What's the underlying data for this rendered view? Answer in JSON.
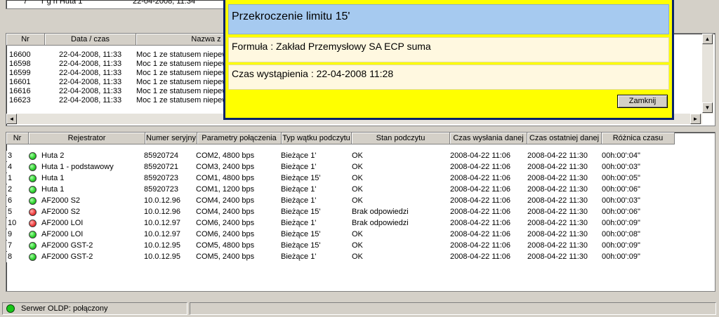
{
  "top_row": {
    "nr": "7",
    "text": "T g h Huta 1",
    "date": "22-04-2008, 11:34"
  },
  "events": {
    "headers": {
      "nr": "Nr",
      "date": "Data / czas",
      "name": "Nazwa z"
    },
    "rows": [
      {
        "nr": "16600",
        "date": "22-04-2008, 11:33",
        "name": "Moc 1 ze statusem niepew"
      },
      {
        "nr": "16598",
        "date": "22-04-2008, 11:33",
        "name": "Moc 1 ze statusem niepew"
      },
      {
        "nr": "16599",
        "date": "22-04-2008, 11:33",
        "name": "Moc 1 ze statusem niepew"
      },
      {
        "nr": "16601",
        "date": "22-04-2008, 11:33",
        "name": "Moc 1 ze statusem niepew"
      },
      {
        "nr": "16616",
        "date": "22-04-2008, 11:33",
        "name": "Moc 1 ze statusem niepew"
      },
      {
        "nr": "16623",
        "date": "22-04-2008, 11:33",
        "name": "Moc 1 ze statusem niepew"
      }
    ]
  },
  "dialog": {
    "title": "Przekroczenie limitu 15'",
    "formula": "Formuła : Zakład Przemysłowy SA ECP suma",
    "time": "Czas wystąpienia : 22-04-2008 11:28",
    "close_label": "Zamknij"
  },
  "registers": {
    "headers": {
      "nr": "Nr",
      "rej": "Rejestrator",
      "serial": "Numer seryjny",
      "params": "Parametry połączenia",
      "thread": "Typ wątku podczytu",
      "state": "Stan podczytu",
      "sent": "Czas wysłania danej",
      "last": "Czas ostatniej danej",
      "diff": "Różnica czasu"
    },
    "rows": [
      {
        "nr": "3",
        "status": "ok",
        "rej": "Huta 2",
        "serial": "85920724",
        "params": "COM2, 4800 bps",
        "thread": "Bieżące 1'",
        "state": "OK",
        "sent": "2008-04-22 11:06",
        "last": "2008-04-22 11:30",
        "diff": "00h:00':04\""
      },
      {
        "nr": "4",
        "status": "ok",
        "rej": "Huta 1 - podstawowy",
        "serial": "85920721",
        "params": "COM3, 2400 bps",
        "thread": "Bieżące 1'",
        "state": "OK",
        "sent": "2008-04-22 11:06",
        "last": "2008-04-22 11:30",
        "diff": "00h:00':03\""
      },
      {
        "nr": "1",
        "status": "ok",
        "rej": "Huta 1",
        "serial": "85920723",
        "params": "COM1, 4800 bps",
        "thread": "Bieżące 15'",
        "state": "OK",
        "sent": "2008-04-22 11:06",
        "last": "2008-04-22 11:30",
        "diff": "00h:00':05\""
      },
      {
        "nr": "2",
        "status": "ok",
        "rej": "Huta 1",
        "serial": "85920723",
        "params": "COM1, 1200 bps",
        "thread": "Bieżące 1'",
        "state": "OK",
        "sent": "2008-04-22 11:06",
        "last": "2008-04-22 11:30",
        "diff": "00h:00':06\""
      },
      {
        "nr": "6",
        "status": "ok",
        "rej": "AF2000 S2",
        "serial": "10.0.12.96",
        "params": "COM4, 2400 bps",
        "thread": "Bieżące 1'",
        "state": "OK",
        "sent": "2008-04-22 11:06",
        "last": "2008-04-22 11:30",
        "diff": "00h:00':03\""
      },
      {
        "nr": "5",
        "status": "err",
        "rej": "AF2000 S2",
        "serial": "10.0.12.96",
        "params": "COM4, 2400 bps",
        "thread": "Bieżące 15'",
        "state": "Brak odpowiedzi",
        "sent": "2008-04-22 11:06",
        "last": "2008-04-22 11:30",
        "diff": "00h:00':06\""
      },
      {
        "nr": "10",
        "status": "err",
        "rej": "AF2000 LOI",
        "serial": "10.0.12.97",
        "params": "COM6, 2400 bps",
        "thread": "Bieżące 1'",
        "state": "Brak odpowiedzi",
        "sent": "2008-04-22 11:06",
        "last": "2008-04-22 11:30",
        "diff": "00h:00':09\""
      },
      {
        "nr": "9",
        "status": "ok",
        "rej": "AF2000 LOI",
        "serial": "10.0.12.97",
        "params": "COM6, 2400 bps",
        "thread": "Bieżące 15'",
        "state": "OK",
        "sent": "2008-04-22 11:06",
        "last": "2008-04-22 11:30",
        "diff": "00h:00':08\""
      },
      {
        "nr": "7",
        "status": "ok",
        "rej": "AF2000 GST-2",
        "serial": "10.0.12.95",
        "params": "COM5, 4800 bps",
        "thread": "Bieżące 15'",
        "state": "OK",
        "sent": "2008-04-22 11:06",
        "last": "2008-04-22 11:30",
        "diff": "00h:00':09\""
      },
      {
        "nr": "8",
        "status": "ok",
        "rej": "AF2000 GST-2",
        "serial": "10.0.12.95",
        "params": "COM5, 2400 bps",
        "thread": "Bieżące 1'",
        "state": "OK",
        "sent": "2008-04-22 11:06",
        "last": "2008-04-22 11:30",
        "diff": "00h:00':09\""
      }
    ]
  },
  "status_bar": {
    "text": "Serwer OLDP: połączony",
    "indicator_color": "#19c619"
  },
  "colors": {
    "dialog_bg": "#ffff00",
    "dialog_title_bg": "#a6caf0",
    "dialog_field_bg": "#fff8e0",
    "dialog_border": "#0a246a"
  },
  "icons": {
    "scroll_up": "▲",
    "scroll_down": "▼",
    "scroll_left": "◄",
    "scroll_right": "►"
  }
}
